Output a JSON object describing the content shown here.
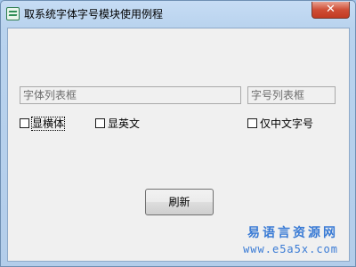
{
  "window": {
    "title": "取系统字体字号模块使用例程",
    "close_label": "✕",
    "icon": "app-logo-icon"
  },
  "form": {
    "font_list": {
      "placeholder": "字体列表框"
    },
    "size_list": {
      "placeholder": "字号列表框"
    },
    "checkboxes": [
      {
        "label": "显横体",
        "checked": false
      },
      {
        "label": "显英文",
        "checked": false
      },
      {
        "label": "仅中文字号",
        "checked": false
      }
    ],
    "refresh_label": "刷新"
  },
  "watermark": {
    "site_name": "易语言资源网",
    "url": "www.e5a5x.com"
  },
  "colors": {
    "titlebar": "#b9d3ee",
    "client_bg": "#f0f0f0",
    "close_button": "#c23a22",
    "watermark": "#3a7bd5"
  }
}
